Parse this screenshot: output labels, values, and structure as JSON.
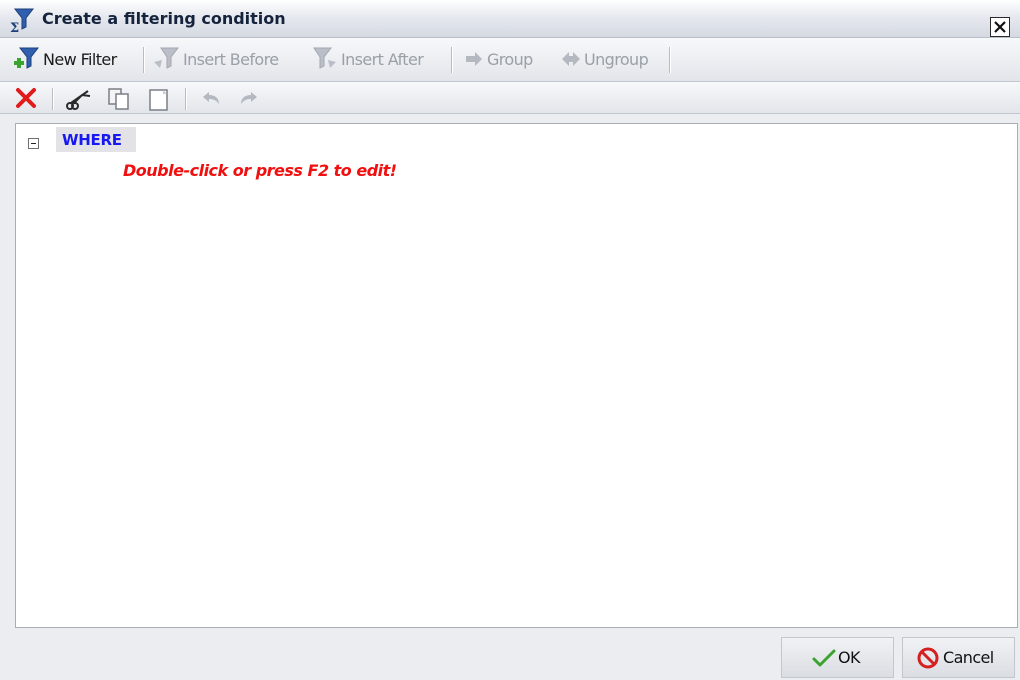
{
  "dialog": {
    "title": "Create a filtering condition",
    "close_label": "×"
  },
  "toolbar": {
    "new_filter": "New Filter",
    "insert_before": "Insert Before",
    "insert_after": "Insert After",
    "group": "Group",
    "ungroup": "Ungroup",
    "icons": [
      "delete-icon",
      "cut-icon",
      "copy-icon",
      "paste-icon",
      "undo-icon",
      "redo-icon"
    ]
  },
  "tree": {
    "root_label": "WHERE",
    "hint": "Double-click or press F2 to edit!"
  },
  "footer": {
    "ok_label": "OK",
    "cancel_label": "Cancel"
  },
  "colors": {
    "where_text": "#1818f0",
    "hint_text": "#f01010",
    "ok_check": "#3aa52e",
    "cancel_icon": "#d42020"
  }
}
